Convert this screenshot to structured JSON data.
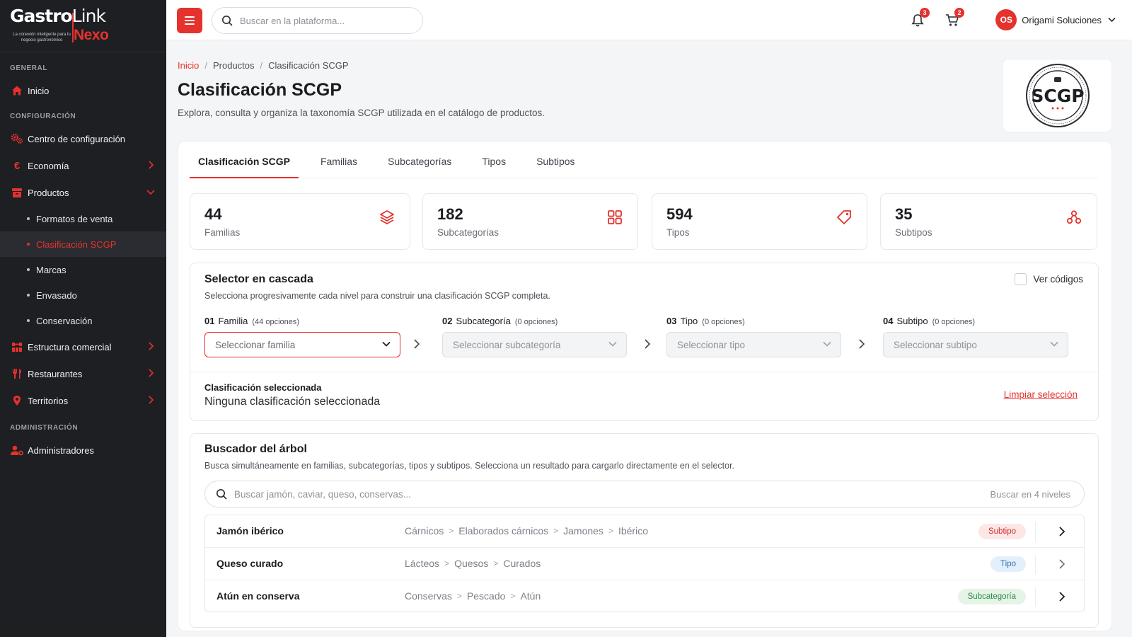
{
  "colors": {
    "accent": "#e5322d",
    "sidebar_bg": "#1d1f23"
  },
  "logo": {
    "word1": "Gastro",
    "word2": "Link",
    "word3": "Nexo",
    "tagline": "La conexión inteligente para tu negocio gastronómico"
  },
  "sidebar": {
    "sections": [
      {
        "label": "GENERAL"
      },
      {
        "label": "CONFIGURACIÓN"
      },
      {
        "label": "ADMINISTRACIÓN"
      }
    ],
    "items": [
      {
        "label": "Inicio",
        "icon": "home-icon"
      },
      {
        "label": "Centro de configuración",
        "icon": "gears-icon"
      },
      {
        "label": "Economía",
        "icon": "euro-icon"
      },
      {
        "label": "Productos",
        "icon": "box-icon"
      },
      {
        "label": "Estructura comercial",
        "icon": "sitemap-icon"
      },
      {
        "label": "Restaurantes",
        "icon": "utensils-icon"
      },
      {
        "label": "Territorios",
        "icon": "map-pin-icon"
      },
      {
        "label": "Administradores",
        "icon": "user-gear-icon"
      }
    ],
    "sub_items": [
      {
        "label": "Formatos de venta"
      },
      {
        "label": "Clasificación SCGP"
      },
      {
        "label": "Marcas"
      },
      {
        "label": "Envasado"
      },
      {
        "label": "Conservación"
      }
    ]
  },
  "topbar": {
    "search_placeholder": "Buscar en la plataforma...",
    "notifications_count": "3",
    "cart_count": "2",
    "user_initials": "OS",
    "user_name": "Origami Soluciones"
  },
  "breadcrumb": [
    "Inicio",
    "Productos",
    "Clasificación SCGP"
  ],
  "page": {
    "title": "Clasificación SCGP",
    "description": "Explora, consulta y organiza la taxonomía SCGP utilizada en el catálogo de productos."
  },
  "brand_seal": {
    "text": "SCGP"
  },
  "tabs": [
    "Clasificación SCGP",
    "Familias",
    "Subcategorías",
    "Tipos",
    "Subtipos"
  ],
  "stats": [
    {
      "value": "44",
      "label": "Familias",
      "icon": "layers-icon"
    },
    {
      "value": "182",
      "label": "Subcategorías",
      "icon": "grid-icon"
    },
    {
      "value": "594",
      "label": "Tipos",
      "icon": "tag-icon"
    },
    {
      "value": "35",
      "label": "Subtipos",
      "icon": "nodes-icon"
    }
  ],
  "cascade": {
    "title": "Selector en cascada",
    "description": "Selecciona progresivamente cada nivel para construir una clasificación SCGP completa.",
    "toggle_label": "Ver códigos",
    "steps": [
      {
        "num": "01",
        "label": "Familia",
        "options": "(44 opciones)",
        "placeholder": "Seleccionar familia"
      },
      {
        "num": "02",
        "label": "Subcategoría",
        "options": "(0 opciones)",
        "placeholder": "Seleccionar subcategoría"
      },
      {
        "num": "03",
        "label": "Tipo",
        "options": "(0 opciones)",
        "placeholder": "Seleccionar tipo"
      },
      {
        "num": "04",
        "label": "Subtipo",
        "options": "(0 opciones)",
        "placeholder": "Seleccionar subtipo"
      }
    ],
    "selected_title": "Clasificación seleccionada",
    "selected_value": "Ninguna clasificación seleccionada",
    "clear_label": "Limpiar selección"
  },
  "tree": {
    "title": "Buscador del árbol",
    "description": "Busca simultáneamente en familias, subcategorías, tipos y subtipos. Selecciona un resultado para cargarlo directamente en el selector.",
    "search_placeholder": "Buscar jamón, caviar, queso, conservas...",
    "search_hint": "Buscar en 4 niveles",
    "results": [
      {
        "name": "Jamón ibérico",
        "path": [
          "Cárnicos",
          "Elaborados cárnicos",
          "Jamones",
          "Ibérico"
        ],
        "tag": "Subtipo",
        "tag_bg": "#fde7e6",
        "tag_fg": "#c9302c"
      },
      {
        "name": "Queso curado",
        "path": [
          "Lácteos",
          "Quesos",
          "Curados"
        ],
        "tag": "Tipo",
        "tag_bg": "#e3f0fb",
        "tag_fg": "#2f6fb0"
      },
      {
        "name": "Atún en conserva",
        "path": [
          "Conservas",
          "Pescado",
          "Atún"
        ],
        "tag": "Subcategoría",
        "tag_bg": "#e4f4e7",
        "tag_fg": "#2e8a44"
      }
    ]
  }
}
